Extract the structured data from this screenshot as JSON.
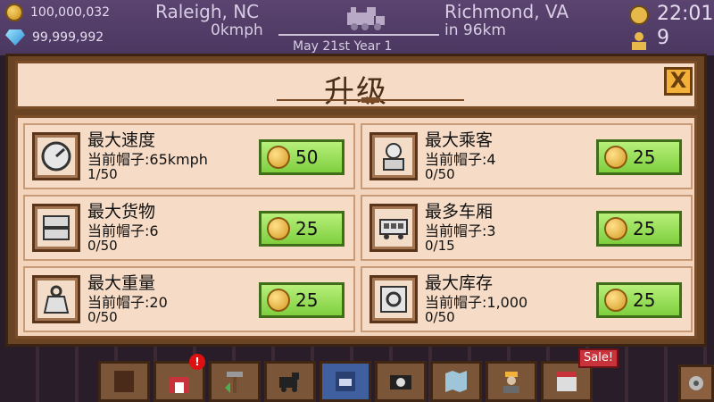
{
  "hud": {
    "coins": "100,000,032",
    "gems": "99,999,992",
    "from_city": "Raleigh, NC",
    "speed": "0kmph",
    "to_city": "Richmond, VA",
    "distance": "in 96km",
    "date": "May 21st Year 1",
    "time": "22:01",
    "passengers": "9"
  },
  "dialog": {
    "title": "升级",
    "close_label": "X"
  },
  "upgrades": [
    {
      "name": "最大速度",
      "current": "当前帽子:65kmph",
      "progress": "1/50",
      "price": "50",
      "icon": "speedometer-icon"
    },
    {
      "name": "最大乘客",
      "current": "当前帽子:4",
      "progress": "0/50",
      "price": "25",
      "icon": "passenger-icon"
    },
    {
      "name": "最大货物",
      "current": "当前帽子:6",
      "progress": "0/50",
      "price": "25",
      "icon": "cargo-icon"
    },
    {
      "name": "最多车厢",
      "current": "当前帽子:3",
      "progress": "0/15",
      "price": "25",
      "icon": "railcar-icon"
    },
    {
      "name": "最大重量",
      "current": "当前帽子:20",
      "progress": "0/50",
      "price": "25",
      "icon": "weight-icon"
    },
    {
      "name": "最大库存",
      "current": "当前帽子:1,000",
      "progress": "0/50",
      "price": "25",
      "icon": "safe-icon"
    }
  ],
  "toolbar": {
    "sale_label": "Sale!",
    "alert_label": "!",
    "items": [
      "book-icon",
      "station-upgrade-icon",
      "hammer-icon",
      "train-icon",
      "train-catalog-icon",
      "camera-icon",
      "map-icon",
      "worker-icon",
      "shop-icon"
    ]
  },
  "colors": {
    "accent_green": "#7fcf3f",
    "panel": "#f3d5bd",
    "frame": "#6b4423"
  }
}
